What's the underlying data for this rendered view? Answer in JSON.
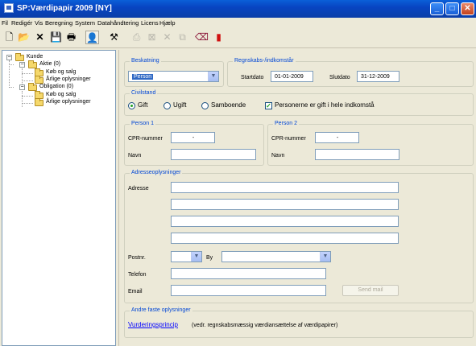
{
  "window": {
    "title": "SP:Værdipapir 2009 [NY]",
    "buttons": {
      "minimize": "_",
      "maximize": "□",
      "close": "✕"
    }
  },
  "menu": [
    "Fil",
    "Redigér",
    "Vis",
    "Beregning",
    "System",
    "Datahåndtering",
    "Licens",
    "Hjælp"
  ],
  "toolbar": [
    {
      "name": "new-icon",
      "glyph": "🗋"
    },
    {
      "name": "open-folder-icon",
      "glyph": "📂"
    },
    {
      "name": "delete-icon",
      "glyph": "✕"
    },
    {
      "name": "save-icon",
      "glyph": "💾"
    },
    {
      "name": "print-icon",
      "glyph": "🖶"
    },
    {
      "name": "person-icon",
      "glyph": "👤"
    },
    {
      "name": "calculate-icon",
      "glyph": "⚒"
    },
    {
      "name": "export-icon",
      "glyph": "⎙"
    },
    {
      "name": "grid-icon",
      "glyph": "⊠"
    },
    {
      "name": "cross-icon",
      "glyph": "✕"
    },
    {
      "name": "copy-icon",
      "glyph": "⧉"
    },
    {
      "name": "eraser-icon",
      "glyph": "⌫"
    },
    {
      "name": "exit-icon",
      "glyph": "▮"
    }
  ],
  "tree": {
    "root": "Kunde",
    "aktie": "Aktie (0)",
    "aktie_children": [
      "Køb og salg",
      "Årlige oplysninger"
    ],
    "obligation": "Obligation (0)",
    "obligation_children": [
      "Køb og salg",
      "Årlige oplysninger"
    ]
  },
  "beskatning": {
    "label": "Beskatning",
    "value": "Person"
  },
  "regnskab": {
    "label": "Regnskabs-/indkomstår",
    "startdato_label": "Startdato",
    "startdato": "01-01-2009",
    "slutdato_label": "Slutdato",
    "slutdato": "31-12-2009"
  },
  "civilstand": {
    "label": "Civilstand",
    "options": [
      "Gift",
      "Ugift",
      "Samboende"
    ],
    "selected": "Gift",
    "gift_hele_aaret_label": "Personerne er gift i hele indkomstå",
    "gift_hele_aaret_checked": true
  },
  "person1": {
    "label": "Person 1",
    "cpr_label": "CPR-nummer",
    "cpr_value": "-",
    "navn_label": "Navn",
    "navn_value": ""
  },
  "person2": {
    "label": "Person 2",
    "cpr_label": "CPR-nummer",
    "cpr_value": "-",
    "navn_label": "Navn",
    "navn_value": ""
  },
  "adresse": {
    "label": "Adresseoplysninger",
    "adresse_label": "Adresse",
    "lines": [
      "",
      "",
      "",
      ""
    ],
    "postnr_label": "Postnr.",
    "postnr_value": "",
    "by_label": "By",
    "by_value": "",
    "telefon_label": "Telefon",
    "telefon_value": "",
    "email_label": "Email",
    "email_value": "",
    "send_mail_label": "Send mail"
  },
  "andre": {
    "label": "Andre faste oplysninger",
    "link_label": "Vurderingsprincip",
    "link_note": "(vedr. regnskabsmæssig værdiansættelse af værdipapirer)"
  },
  "colors": {
    "accent_label": "#0046d5",
    "titlebar": "#0a5fd8",
    "link": "#0000ff"
  }
}
